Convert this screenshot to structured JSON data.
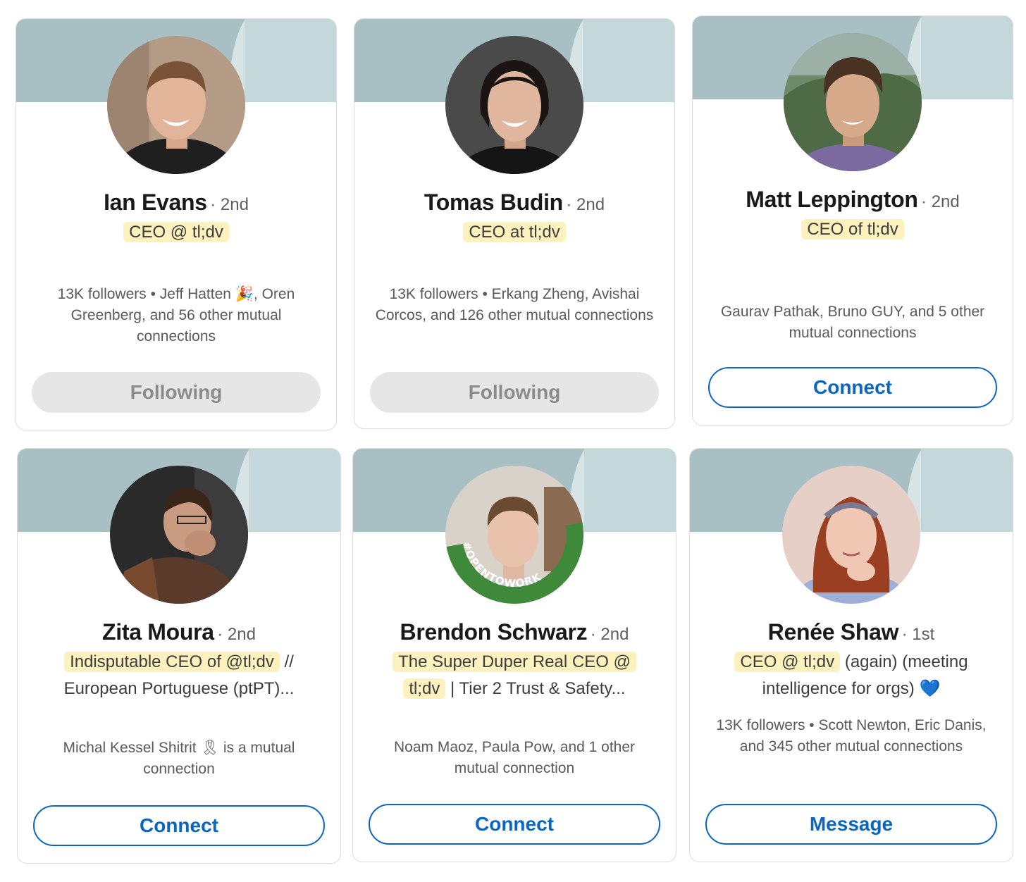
{
  "colors": {
    "accent": "#0a66c2",
    "highlight": "#fdf1bd",
    "banner": "#a8c0c4",
    "following_bg": "#e6e6e6"
  },
  "cards": [
    {
      "name": "Ian Evans",
      "degree": "· 2nd",
      "headline_highlight": "CEO @ tl;dv",
      "headline_rest": "",
      "mutual": "13K followers • Jeff Hatten 🎉, Oren Greenberg, and 56 other mutual connections",
      "button": "Following"
    },
    {
      "name": "Tomas Budin",
      "degree": "· 2nd",
      "headline_highlight": "CEO at tl;dv",
      "headline_rest": "",
      "mutual": "13K followers • Erkang Zheng, Avishai Corcos, and 126 other mutual connections",
      "button": "Following"
    },
    {
      "name": "Matt Leppington",
      "degree": "· 2nd",
      "headline_highlight": "CEO of tl;dv",
      "headline_rest": "",
      "mutual": "Gaurav Pathak, Bruno GUY, and 5 other mutual connections",
      "button": "Connect"
    },
    {
      "name": "Zita Moura",
      "degree": "· 2nd",
      "headline_highlight": "Indisputable CEO of @tl;dv",
      "headline_rest": " // European Portuguese (ptPT)...",
      "mutual": "Michal Kessel Shitrit 🎗 is a mutual connection",
      "button": "Connect"
    },
    {
      "name": "Brendon Schwarz",
      "degree": "· 2nd",
      "headline_highlight": "The Super Duper Real CEO @ tl;dv",
      "headline_rest": " | Tier 2 Trust & Safety...",
      "mutual": "Noam Maoz, Paula Pow, and 1 other mutual connection",
      "button": "Connect",
      "badge": "#OPENTOWORK"
    },
    {
      "name": "Renée Shaw",
      "degree": "· 1st",
      "headline_highlight": "CEO @ tl;dv",
      "headline_rest": " (again) (meeting intelligence for orgs) 💙",
      "mutual": "13K followers • Scott Newton, Eric Danis, and 345 other mutual connections",
      "button": "Message"
    }
  ]
}
